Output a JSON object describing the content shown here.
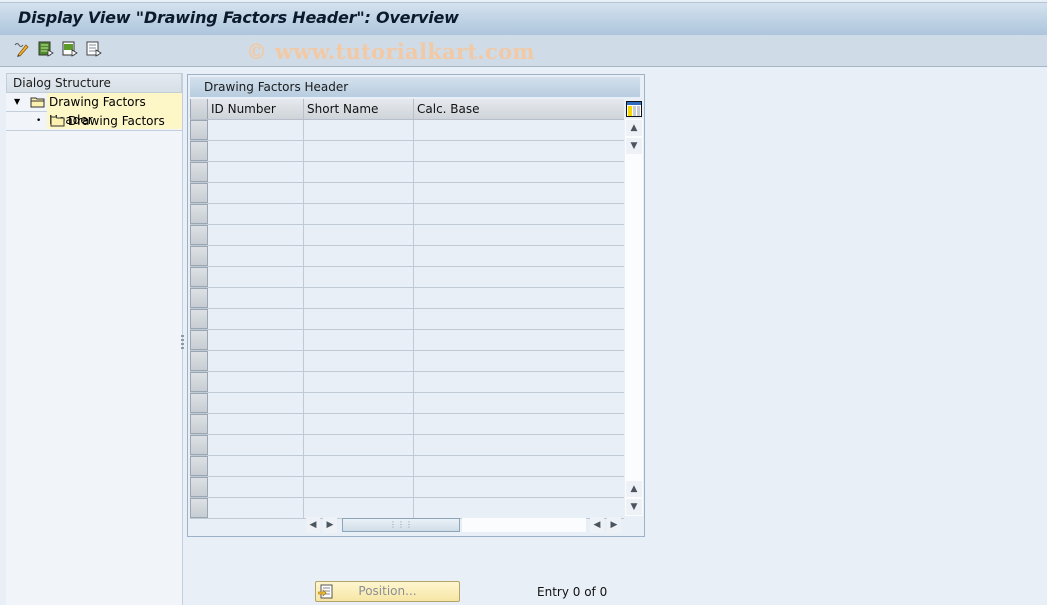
{
  "window": {
    "title": "Display View \"Drawing Factors Header\": Overview",
    "watermark": "© www.tutorialkart.com"
  },
  "toolbar": {
    "buttons": [
      {
        "name": "display-change-icon"
      },
      {
        "name": "select-all-icon"
      },
      {
        "name": "select-block-icon"
      },
      {
        "name": "deselect-all-icon"
      }
    ]
  },
  "dialog_structure": {
    "header": "Dialog Structure",
    "items": [
      {
        "label": "Drawing Factors Header",
        "level": 0,
        "expanded": true,
        "selected": true
      },
      {
        "label": "Drawing Factors",
        "level": 1,
        "expanded": false,
        "selected": false
      }
    ]
  },
  "table": {
    "title": "Drawing Factors Header",
    "columns": [
      "ID Number",
      "Short Name",
      "Calc. Base"
    ],
    "rows": [
      [
        "",
        "",
        ""
      ],
      [
        "",
        "",
        ""
      ],
      [
        "",
        "",
        ""
      ],
      [
        "",
        "",
        ""
      ],
      [
        "",
        "",
        ""
      ],
      [
        "",
        "",
        ""
      ],
      [
        "",
        "",
        ""
      ],
      [
        "",
        "",
        ""
      ],
      [
        "",
        "",
        ""
      ],
      [
        "",
        "",
        ""
      ],
      [
        "",
        "",
        ""
      ],
      [
        "",
        "",
        ""
      ],
      [
        "",
        "",
        ""
      ],
      [
        "",
        "",
        ""
      ],
      [
        "",
        "",
        ""
      ],
      [
        "",
        "",
        ""
      ],
      [
        "",
        "",
        ""
      ],
      [
        "",
        "",
        ""
      ],
      [
        "",
        "",
        ""
      ]
    ]
  },
  "footer": {
    "position_button": "Position...",
    "entry_status": "Entry 0 of 0"
  }
}
